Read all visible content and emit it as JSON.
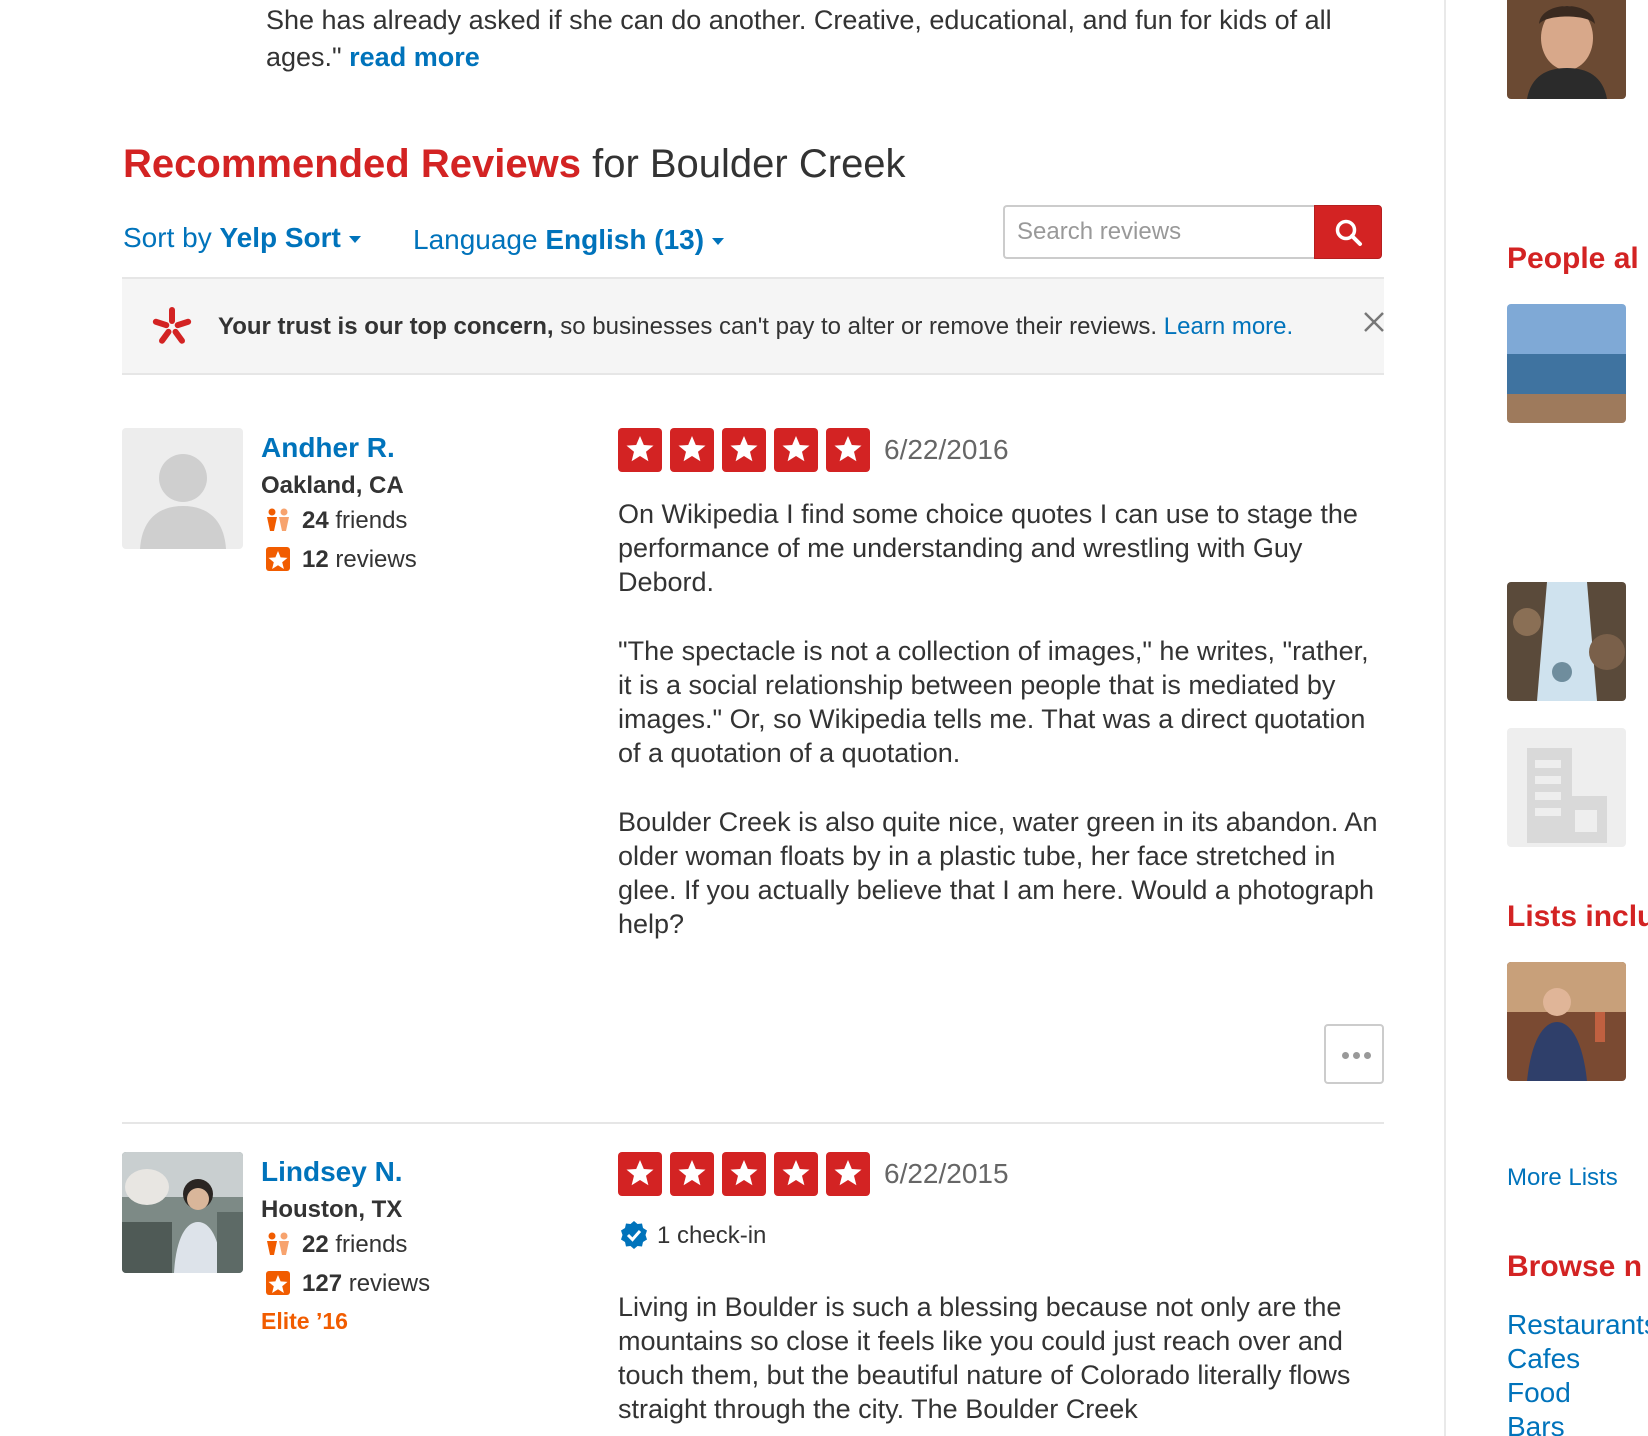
{
  "snippet": {
    "text": "She has already asked if she can do another. Creative, educational, and fun for kids of all ages.\"",
    "read_more": "read more"
  },
  "header": {
    "title_red": "Recommended Reviews",
    "title_rest": "for Boulder Creek"
  },
  "controls": {
    "sort_prefix": "Sort by",
    "sort_value": "Yelp Sort",
    "language_prefix": "Language",
    "language_value": "English (13)",
    "search_placeholder": "Search reviews"
  },
  "trust_banner": {
    "bold": "Your trust is our top concern,",
    "text": "so businesses can't pay to alter or remove their reviews.",
    "link": "Learn more."
  },
  "reviews": [
    {
      "user": {
        "name": "Andher R.",
        "location": "Oakland, CA",
        "friends_count": "24",
        "friends_label": "friends",
        "reviews_count": "12",
        "reviews_label": "reviews"
      },
      "rating": 5,
      "date": "6/22/2016",
      "paragraphs": [
        "On Wikipedia I find some choice quotes I can use to stage the performance of me understanding and wrestling with Guy Debord.",
        "\"The spectacle is not a collection of images,\" he writes, \"rather, it is a social relationship between people that is mediated by images.\" Or, so Wikipedia tells me. That was a direct quotation of a quotation of a quotation.",
        "Boulder Creek is also quite nice, water green in its abandon. An older woman floats by in a plastic tube, her face stretched in glee. If you actually believe that I am here. Would a photograph help?"
      ]
    },
    {
      "user": {
        "name": "Lindsey N.",
        "location": "Houston, TX",
        "friends_count": "22",
        "friends_label": "friends",
        "reviews_count": "127",
        "reviews_label": "reviews",
        "elite": "Elite ’16"
      },
      "rating": 5,
      "date": "6/22/2015",
      "checkin": "1 check-in",
      "paragraphs": [
        "Living in Boulder is such a blessing because not only are the mountains so close it feels like you could just reach over and touch them, but the beautiful nature of Colorado literally flows straight through the city. The Boulder Creek"
      ]
    }
  ],
  "sidebar": {
    "people_heading": "People al",
    "lists_heading": "Lists inclu",
    "more_lists": "More Lists",
    "browse_heading": "Browse n",
    "browse_links": [
      "Restaurants",
      "Cafes",
      "Food",
      "Bars"
    ]
  },
  "colors": {
    "brand_red": "#d32323",
    "link_blue": "#0073bb",
    "elite_orange": "#f15c00"
  }
}
